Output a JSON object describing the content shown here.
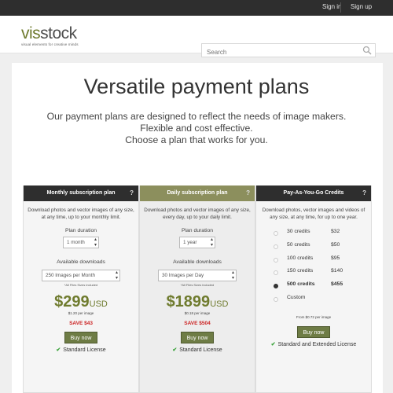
{
  "topbar": {
    "signin": "Sign in",
    "signup": "Sign up"
  },
  "brand": {
    "logo_vis": "vis",
    "logo_stock": "stock",
    "tagline": "visual elements for creative minds"
  },
  "search": {
    "placeholder": "Search"
  },
  "hero": {
    "title": "Versatile payment plans",
    "line1": "Our payment plans are designed to reflect the needs of image makers.",
    "line2": "Flexible and cost effective.",
    "line3": "Choose a plan that works for you."
  },
  "plans": [
    {
      "header": "Monthly subscription plan",
      "help": "?",
      "desc": "Download photos and vector images of any size, at any time, up to your monthly limit.",
      "duration_label": "Plan duration",
      "duration_value": "1 month",
      "downloads_label": "Available downloads",
      "downloads_value": "250 Images per Month",
      "note": "*All Files Sizes included",
      "price": "$299",
      "currency": "USD",
      "per_image": "$1.20 per image",
      "save": "SAVE $43",
      "button": "Buy now",
      "license": "Standard License"
    },
    {
      "header": "Daily subscription plan",
      "help": "?",
      "desc": "Download photos and vector images of any size, every day, up to your daily limit.",
      "duration_label": "Plan duration",
      "duration_value": "1 year",
      "downloads_label": "Available downloads",
      "downloads_value": "30 Images per Day",
      "note": "*All Files Sizes included",
      "price": "$1899",
      "currency": "USD",
      "per_image": "$0.18 per image",
      "save": "SAVE $504",
      "button": "Buy now",
      "license": "Standard License"
    },
    {
      "header": "Pay-As-You-Go Credits",
      "help": "?",
      "desc": "Download photos, vector images and videos of any size, at any time, for up to one year.",
      "credits": [
        {
          "name": "30 credits",
          "price": "$32",
          "selected": false
        },
        {
          "name": "50 credits",
          "price": "$50",
          "selected": false
        },
        {
          "name": "100 credits",
          "price": "$95",
          "selected": false
        },
        {
          "name": "150 credits",
          "price": "$140",
          "selected": false
        },
        {
          "name": "500 credits",
          "price": "$455",
          "selected": true
        },
        {
          "name": "Custom",
          "price": "",
          "selected": false
        }
      ],
      "from_price": "From $0.72 per image",
      "button": "Buy now",
      "license": "Standard and Extended License"
    }
  ],
  "colors": {
    "accent": "#6f7b2e",
    "button": "#6e7c45",
    "save": "#cc2222",
    "dark_header": "#2e2e2e",
    "olive_header": "#8c8f5d"
  }
}
